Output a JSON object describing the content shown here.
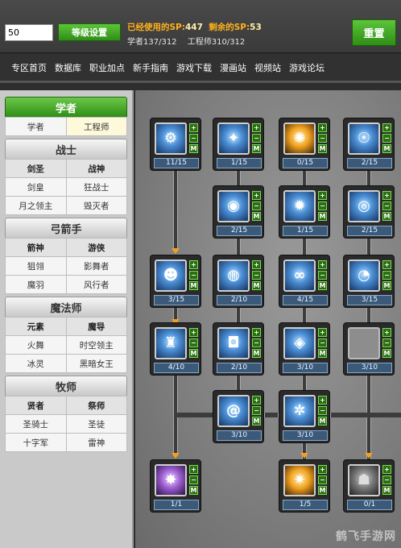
{
  "toolbar": {
    "level_value": "50",
    "set_level_label": "等级设置",
    "reset_label": "重置",
    "sp_used_label": "已经使用的SP:",
    "sp_used_value": "447",
    "sp_remaining_label": "剩余的SP:",
    "sp_remaining_value": "53",
    "points_scholar": "学者137/312",
    "points_engineer": "工程师310/312"
  },
  "nav": {
    "items": [
      "专区首页",
      "数据库",
      "职业加点",
      "新手指南",
      "游戏下载",
      "漫画站",
      "视频站",
      "游戏论坛"
    ]
  },
  "classes": [
    {
      "name": "学者",
      "active": true,
      "subs": [
        [
          "学者",
          "工程师"
        ]
      ]
    },
    {
      "name": "战士",
      "subs": [
        [
          "剑圣",
          "战神"
        ],
        [
          "剑皇",
          "狂战士"
        ],
        [
          "月之领主",
          "毁灭者"
        ]
      ]
    },
    {
      "name": "弓箭手",
      "subs": [
        [
          "箭神",
          "游侠"
        ],
        [
          "狙翎",
          "影舞者"
        ],
        [
          "魔羽",
          "风行者"
        ]
      ]
    },
    {
      "name": "魔法师",
      "subs": [
        [
          "元素",
          "魔导"
        ],
        [
          "火舞",
          "时空领主"
        ],
        [
          "冰灵",
          "黑暗女王"
        ]
      ]
    },
    {
      "name": "牧师",
      "subs": [
        [
          "贤者",
          "祭师"
        ],
        [
          "圣骑士",
          "圣徒"
        ],
        [
          "十字军",
          "雷神"
        ]
      ]
    }
  ],
  "skill_controls": {
    "plus": "+",
    "minus": "−",
    "max": "M"
  },
  "skills": [
    {
      "level": "11/15",
      "icon": "mech-skill-icon",
      "glyph": "⚙",
      "style": ""
    },
    {
      "level": "1/15",
      "icon": "wrench-skill-icon",
      "glyph": "✦",
      "style": ""
    },
    {
      "level": "0/15",
      "icon": "fire-burst-skill-icon",
      "glyph": "✺",
      "style": "gold"
    },
    {
      "level": "2/15",
      "icon": "robot-skill-icon",
      "glyph": "☉",
      "style": ""
    },
    {
      "level": "2/15",
      "icon": "orb-skill-icon",
      "glyph": "◉",
      "style": ""
    },
    {
      "level": "1/15",
      "icon": "gear-skill-icon",
      "glyph": "✹",
      "style": ""
    },
    {
      "level": "2/15",
      "icon": "alarm-skill-icon",
      "glyph": "◎",
      "style": ""
    },
    {
      "level": "3/15",
      "icon": "skull-skill-icon",
      "glyph": "☻",
      "style": ""
    },
    {
      "level": "2/10",
      "icon": "shield-orb-skill-icon",
      "glyph": "◍",
      "style": ""
    },
    {
      "level": "4/15",
      "icon": "goggle-skill-icon",
      "glyph": "∞",
      "style": ""
    },
    {
      "level": "3/15",
      "icon": "clock-skill-icon",
      "glyph": "◔",
      "style": ""
    },
    {
      "level": "4/10",
      "icon": "turret-skill-icon",
      "glyph": "♜",
      "style": ""
    },
    {
      "level": "2/10",
      "icon": "helmet-skill-icon",
      "glyph": "◘",
      "style": ""
    },
    {
      "level": "3/10",
      "icon": "drone-skill-icon",
      "glyph": "◈",
      "style": ""
    },
    {
      "level": "3/10",
      "icon": "empty-skill-icon",
      "glyph": "",
      "style": "empty"
    },
    {
      "level": "3/10",
      "icon": "swirl-skill-icon",
      "glyph": "@",
      "style": ""
    },
    {
      "level": "3/10",
      "icon": "robot-head-skill-icon",
      "glyph": "✲",
      "style": ""
    },
    {
      "level": "1/1",
      "icon": "ultimate-purple-skill-icon",
      "glyph": "✸",
      "style": "purple"
    },
    {
      "level": "1/5",
      "icon": "explosion-skill-icon",
      "glyph": "✷",
      "style": "gold"
    },
    {
      "level": "0/1",
      "icon": "locked-robot-skill-icon",
      "glyph": "☗",
      "style": "grey"
    }
  ],
  "watermark": "鹤飞手游网"
}
